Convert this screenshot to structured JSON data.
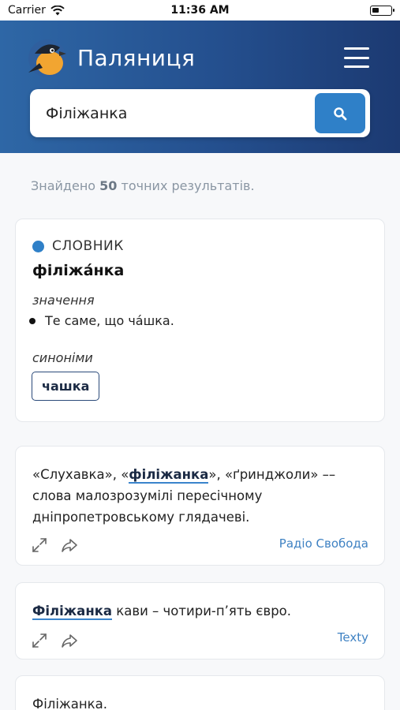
{
  "status_bar": {
    "carrier": "Carrier",
    "time": "11:36 AM"
  },
  "header": {
    "app_title": "Паляниця"
  },
  "search": {
    "value": "Філіжанка"
  },
  "results": {
    "prefix": "Знайдено",
    "count": "50",
    "suffix": "точних результатів."
  },
  "dictionary": {
    "label": "СЛОВНИК",
    "headword": "філіжáнка",
    "meaning_label": "значення",
    "meaning": "Те саме, що чáшка.",
    "synonyms_label": "синоніми",
    "synonyms": [
      "чашка"
    ]
  },
  "quotes": [
    {
      "pre": "«Слухавка», «",
      "highlight": "філіжанка",
      "post": "», «ґринджоли» –– слова малозрозумілі пересічному дніпропетровському глядачеві.",
      "source": "Радіо Свобода"
    },
    {
      "pre": "",
      "highlight": "Філіжанка",
      "post": " кави – чотири-п’ять євро.",
      "source": "Texty"
    },
    {
      "pre": "",
      "highlight": "",
      "post": "Філіжанка.",
      "source": ""
    }
  ],
  "colors": {
    "accent": "#2f80c8",
    "header_start": "#2e67a6",
    "header_end": "#1c3a72",
    "source_link": "#3f82c3"
  }
}
